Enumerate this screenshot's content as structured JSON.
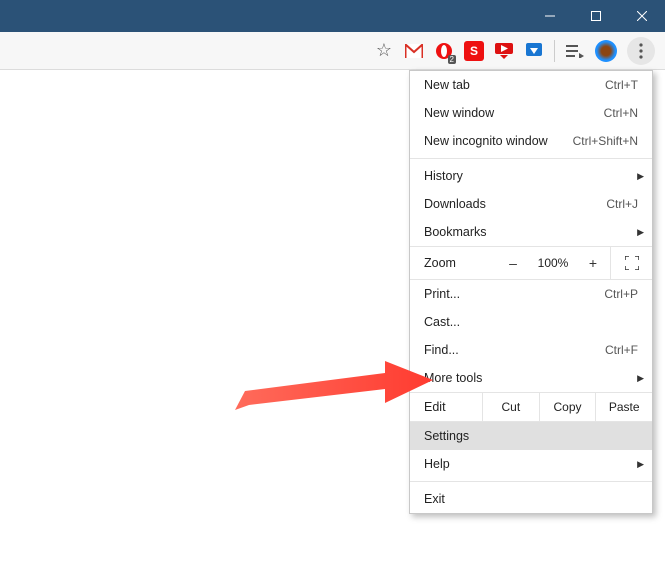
{
  "window_controls": {
    "minimize": "minimize",
    "maximize": "maximize",
    "close": "close"
  },
  "toolbar": {
    "star": "star",
    "extensions": [
      "gmail",
      "opera",
      "skitch",
      "video-dl",
      "idm"
    ],
    "queue": "queue",
    "profile": "profile",
    "menu_button": "dots-vertical"
  },
  "menu": {
    "new_tab": {
      "label": "New tab",
      "shortcut": "Ctrl+T"
    },
    "new_window": {
      "label": "New window",
      "shortcut": "Ctrl+N"
    },
    "new_incognito": {
      "label": "New incognito window",
      "shortcut": "Ctrl+Shift+N"
    },
    "history": {
      "label": "History"
    },
    "downloads": {
      "label": "Downloads",
      "shortcut": "Ctrl+J"
    },
    "bookmarks": {
      "label": "Bookmarks"
    },
    "zoom": {
      "label": "Zoom",
      "minus": "–",
      "value": "100%",
      "plus": "+"
    },
    "print": {
      "label": "Print...",
      "shortcut": "Ctrl+P"
    },
    "cast": {
      "label": "Cast..."
    },
    "find": {
      "label": "Find...",
      "shortcut": "Ctrl+F"
    },
    "more_tools": {
      "label": "More tools"
    },
    "edit": {
      "label": "Edit",
      "cut": "Cut",
      "copy": "Copy",
      "paste": "Paste"
    },
    "settings": {
      "label": "Settings"
    },
    "help": {
      "label": "Help"
    },
    "exit": {
      "label": "Exit"
    }
  }
}
